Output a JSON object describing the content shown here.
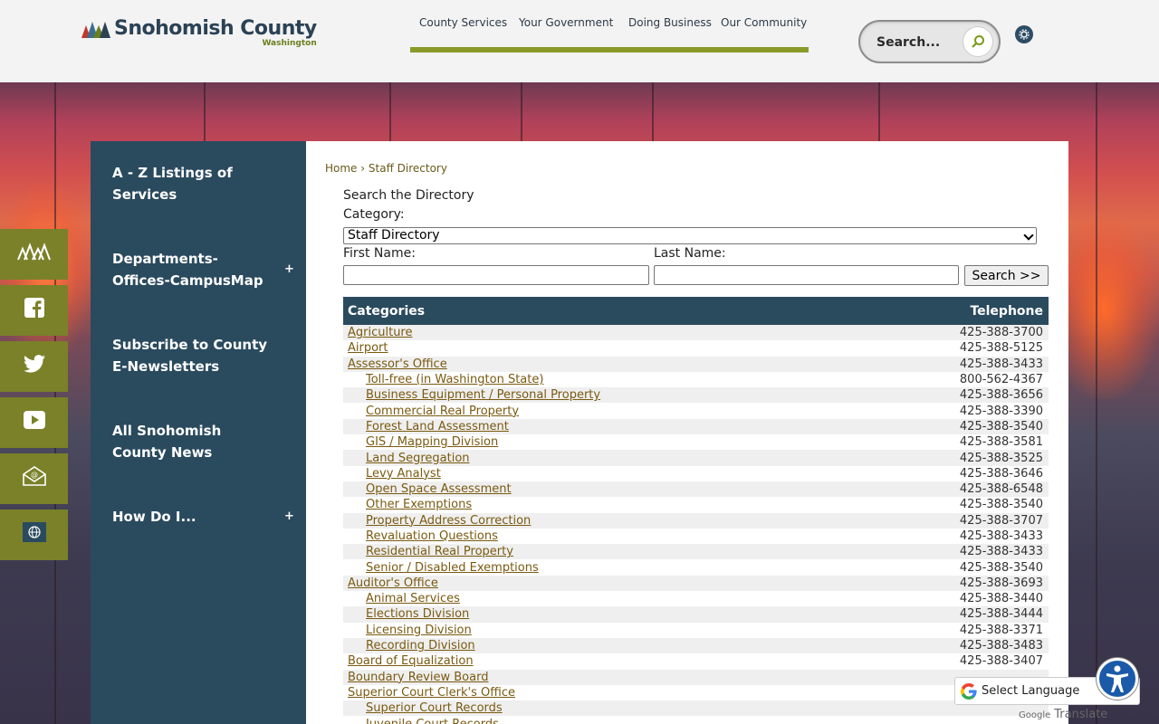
{
  "header": {
    "logo_name": "Snohomish County",
    "logo_sub": "Washington",
    "nav": [
      "County Services",
      "Your Government",
      "Doing Business",
      "Our Community"
    ],
    "search_placeholder": "Search..."
  },
  "sidenav": {
    "items": [
      {
        "label": "A - Z Listings of Services",
        "expandable": false
      },
      {
        "label": "Departments-Offices-CampusMap",
        "expandable": true
      },
      {
        "label": "Subscribe to County E-Newsletters",
        "expandable": false
      },
      {
        "label": "All Snohomish County News",
        "expandable": false
      },
      {
        "label": "How Do I...",
        "expandable": true
      }
    ],
    "plus_symbol": "+"
  },
  "social": [
    "county-logo-icon",
    "facebook-icon",
    "twitter-icon",
    "youtube-icon",
    "email-icon",
    "globe-icon"
  ],
  "breadcrumb": {
    "home": "Home",
    "separator": "›",
    "current": "Staff Directory"
  },
  "form": {
    "heading": "Search the Directory",
    "category_label": "Category:",
    "category_value": "Staff Directory",
    "first_name_label": "First Name:",
    "last_name_label": "Last Name:",
    "first_name_value": "",
    "last_name_value": "",
    "search_button": "Search >>"
  },
  "table": {
    "col_category": "Categories",
    "col_phone": "Telephone",
    "rows": [
      {
        "name": "Agriculture",
        "phone": "425-388-3700",
        "indent": 0
      },
      {
        "name": "Airport",
        "phone": "425-388-5125",
        "indent": 0
      },
      {
        "name": "Assessor's Office",
        "phone": "425-388-3433",
        "indent": 0
      },
      {
        "name": "Toll-free (in Washington State)",
        "phone": "800-562-4367",
        "indent": 1
      },
      {
        "name": "Business Equipment / Personal Property",
        "phone": "425-388-3656",
        "indent": 1
      },
      {
        "name": "Commercial Real Property",
        "phone": "425-388-3390",
        "indent": 1
      },
      {
        "name": "Forest Land Assessment",
        "phone": "425-388-3540",
        "indent": 1
      },
      {
        "name": "GIS / Mapping Division",
        "phone": "425-388-3581",
        "indent": 1
      },
      {
        "name": "Land Segregation",
        "phone": "425-388-3525",
        "indent": 1
      },
      {
        "name": "Levy Analyst",
        "phone": "425-388-3646",
        "indent": 1
      },
      {
        "name": "Open Space Assessment",
        "phone": "425-388-6548",
        "indent": 1
      },
      {
        "name": "Other Exemptions",
        "phone": "425-388-3540",
        "indent": 1
      },
      {
        "name": "Property Address Correction",
        "phone": "425-388-3707",
        "indent": 1
      },
      {
        "name": "Revaluation Questions",
        "phone": "425-388-3433",
        "indent": 1
      },
      {
        "name": "Residential Real Property",
        "phone": "425-388-3433",
        "indent": 1
      },
      {
        "name": "Senior / Disabled Exemptions",
        "phone": "425-388-3540",
        "indent": 1
      },
      {
        "name": "Auditor's Office",
        "phone": "425-388-3693",
        "indent": 0
      },
      {
        "name": "Animal Services",
        "phone": "425-388-3440",
        "indent": 1
      },
      {
        "name": "Elections Division",
        "phone": "425-388-3444",
        "indent": 1
      },
      {
        "name": "Licensing Division",
        "phone": "425-388-3371",
        "indent": 1
      },
      {
        "name": "Recording Division",
        "phone": "425-388-3483",
        "indent": 1
      },
      {
        "name": "Board of Equalization",
        "phone": "425-388-3407",
        "indent": 0
      },
      {
        "name": "Boundary Review Board",
        "phone": "",
        "indent": 0
      },
      {
        "name": "Superior Court Clerk's Office",
        "phone": "",
        "indent": 0
      },
      {
        "name": "Superior Court Records",
        "phone": "",
        "indent": 1
      },
      {
        "name": "Juvenile Court Records",
        "phone": "",
        "indent": 1
      }
    ]
  },
  "translate": {
    "label": "Select Language",
    "powered_by": "Google",
    "translate_word": "Translate"
  },
  "colors": {
    "navy": "#2a4a5e",
    "olive": "#7a8129",
    "link": "#7a5a10"
  }
}
